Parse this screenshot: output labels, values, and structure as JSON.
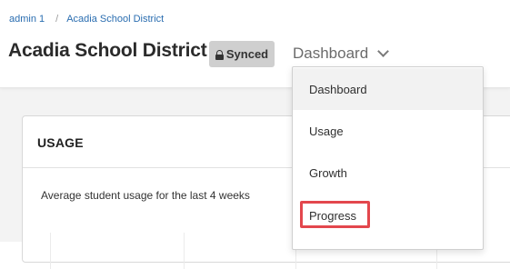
{
  "breadcrumb": {
    "items": [
      "admin 1",
      "Acadia School District"
    ],
    "separator": "/"
  },
  "header": {
    "title": "Acadia School District",
    "badge": "Synced",
    "dashboard_selector": "Dashboard"
  },
  "dropdown": {
    "items": [
      "Dashboard",
      "Usage",
      "Growth",
      "Progress"
    ],
    "active": "Dashboard",
    "highlighted": "Progress"
  },
  "usage_card": {
    "title": "USAGE",
    "subtitle": "Average student usage for the last 4 weeks"
  },
  "colors": {
    "link": "#2a6db0",
    "badge_bg": "#cfcfcf",
    "highlight": "#e3474d",
    "page_bg": "#f3f3f3"
  },
  "icons": [
    "lock-icon",
    "chevron-down-icon"
  ]
}
